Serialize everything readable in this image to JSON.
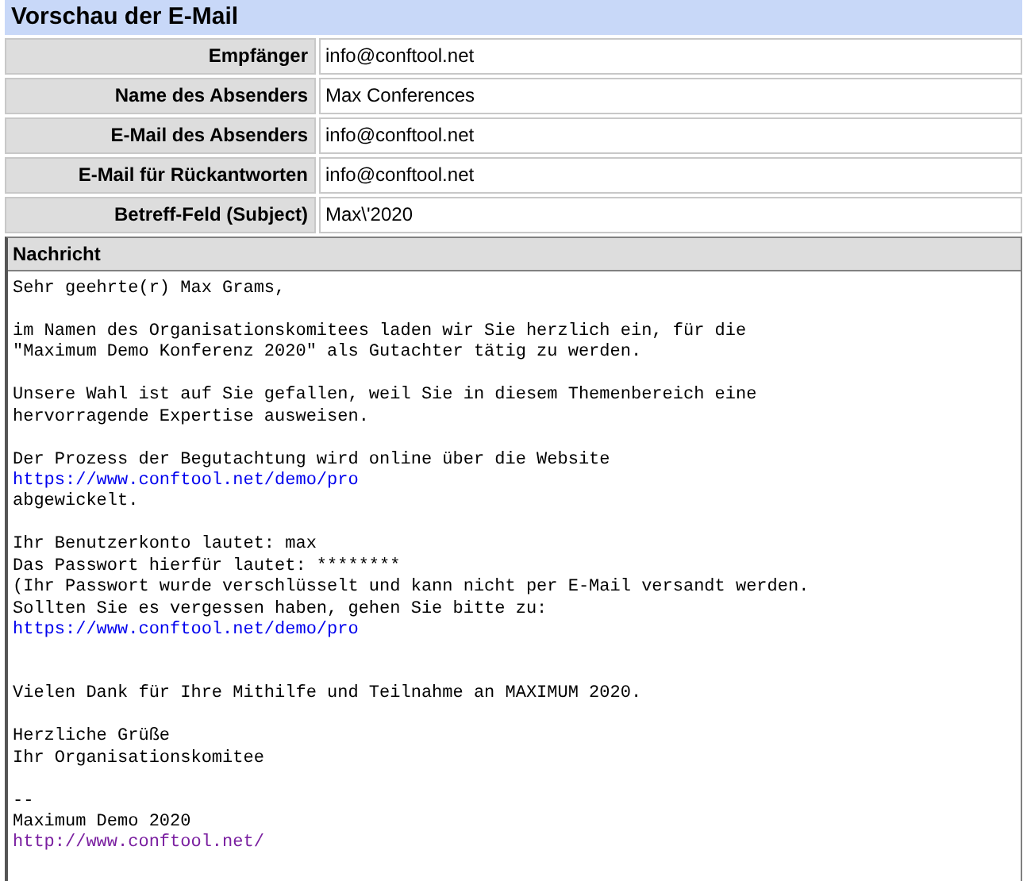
{
  "title": "Vorschau der E-Mail",
  "fields": [
    {
      "label": "Empfänger",
      "value": "info@conftool.net"
    },
    {
      "label": "Name des Absenders",
      "value": "Max Conferences"
    },
    {
      "label": "E-Mail des Absenders",
      "value": "info@conftool.net"
    },
    {
      "label": "E-Mail für Rückantworten",
      "value": "info@conftool.net"
    },
    {
      "label": "Betreff-Feld (Subject)",
      "value": "Max\\'2020"
    }
  ],
  "message": {
    "heading": "Nachricht",
    "lines": [
      {
        "kind": "text",
        "text": "Sehr geehrte(r) Max Grams,"
      },
      {
        "kind": "blank"
      },
      {
        "kind": "text",
        "text": "im Namen des Organisationskomitees laden wir Sie herzlich ein, für die"
      },
      {
        "kind": "text",
        "text": "\"Maximum Demo Konferenz 2020\" als Gutachter tätig zu werden."
      },
      {
        "kind": "blank"
      },
      {
        "kind": "text",
        "text": "Unsere Wahl ist auf Sie gefallen, weil Sie in diesem Themenbereich eine"
      },
      {
        "kind": "text",
        "text": "hervorragende Expertise ausweisen."
      },
      {
        "kind": "blank"
      },
      {
        "kind": "text",
        "text": "Der Prozess der Begutachtung wird online über die Website"
      },
      {
        "kind": "link",
        "text": "https://www.conftool.net/demo/pro",
        "visited": false
      },
      {
        "kind": "text",
        "text": "abgewickelt."
      },
      {
        "kind": "blank"
      },
      {
        "kind": "text",
        "text": "Ihr Benutzerkonto lautet: max"
      },
      {
        "kind": "text",
        "text": "Das Passwort hierfür lautet: ********"
      },
      {
        "kind": "text",
        "text": "(Ihr Passwort wurde verschlüsselt und kann nicht per E-Mail versandt werden."
      },
      {
        "kind": "text",
        "text": "Sollten Sie es vergessen haben, gehen Sie bitte zu:"
      },
      {
        "kind": "link",
        "text": "https://www.conftool.net/demo/pro",
        "visited": false
      },
      {
        "kind": "blank"
      },
      {
        "kind": "blank"
      },
      {
        "kind": "text",
        "text": "Vielen Dank für Ihre Mithilfe und Teilnahme an MAXIMUM 2020."
      },
      {
        "kind": "blank"
      },
      {
        "kind": "text",
        "text": "Herzliche Grüße"
      },
      {
        "kind": "text",
        "text": "Ihr Organisationskomitee"
      },
      {
        "kind": "blank"
      },
      {
        "kind": "text",
        "text": "--"
      },
      {
        "kind": "text",
        "text": "Maximum Demo 2020"
      },
      {
        "kind": "link",
        "text": "http://www.conftool.net/",
        "visited": true
      }
    ]
  }
}
